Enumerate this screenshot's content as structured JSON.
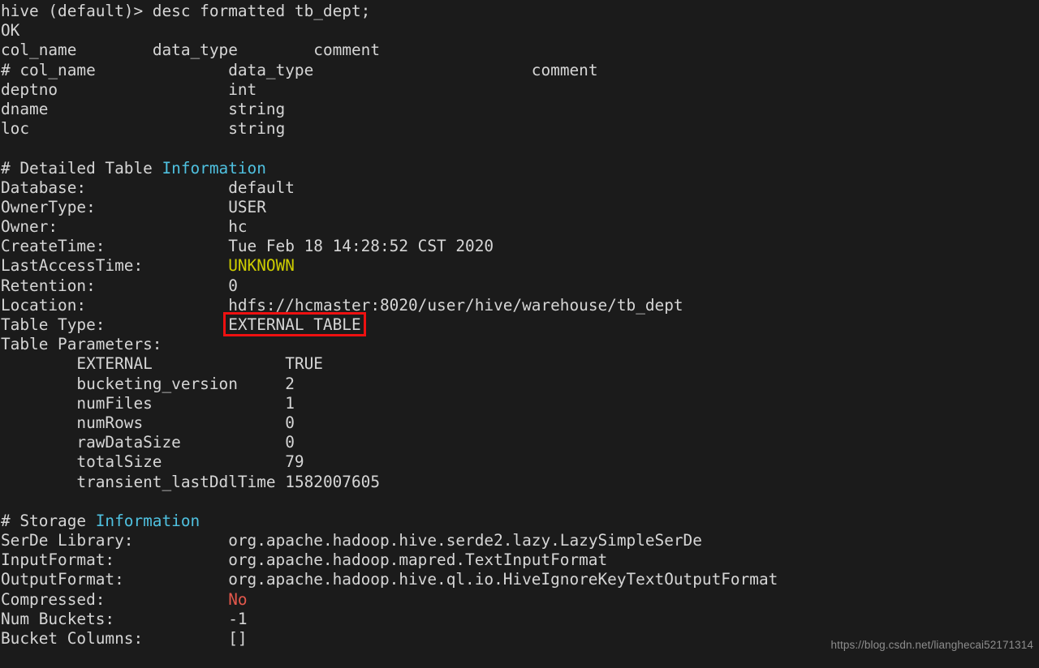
{
  "terminal": {
    "prompt": "hive (default)> ",
    "command": "desc formatted tb_dept;",
    "status_ok": "OK",
    "colors": {
      "background": "#1b1b1b",
      "foreground": "#d6d6d6",
      "cyan": "#4fc1e0",
      "yellow": "#cdcd00",
      "red": "#e4584c",
      "highlight_box": "#ee1111"
    }
  },
  "column_header": {
    "col_name": "col_name",
    "data_type": "data_type",
    "comment": "comment"
  },
  "schema": {
    "header": {
      "col_name": "# col_name",
      "data_type": "data_type",
      "comment": "comment"
    },
    "columns": [
      {
        "name": "deptno",
        "type": "int",
        "comment": ""
      },
      {
        "name": "dname",
        "type": "string",
        "comment": ""
      },
      {
        "name": "loc",
        "type": "string",
        "comment": ""
      }
    ]
  },
  "detailed_table_information": {
    "heading_prefix": "# Detailed Table ",
    "heading_highlight": "Information",
    "rows": [
      {
        "key": "Database:",
        "value": "default"
      },
      {
        "key": "OwnerType:",
        "value": "USER"
      },
      {
        "key": "Owner:",
        "value": "hc"
      },
      {
        "key": "CreateTime:",
        "value": "Tue Feb 18 14:28:52 CST 2020"
      },
      {
        "key": "LastAccessTime:",
        "value": "UNKNOWN"
      },
      {
        "key": "Retention:",
        "value": "0"
      },
      {
        "key": "Location:",
        "value": "hdfs://hcmaster:8020/user/hive/warehouse/tb_dept"
      },
      {
        "key": "Table Type:",
        "value": "EXTERNAL_TABLE"
      }
    ],
    "table_type_display": "EXTERNAL TABLE"
  },
  "table_parameters": {
    "label": "Table Parameters:",
    "entries": [
      {
        "key": "EXTERNAL",
        "value": "TRUE"
      },
      {
        "key": "bucketing_version",
        "value": "2"
      },
      {
        "key": "numFiles",
        "value": "1"
      },
      {
        "key": "numRows",
        "value": "0"
      },
      {
        "key": "rawDataSize",
        "value": "0"
      },
      {
        "key": "totalSize",
        "value": "79"
      },
      {
        "key": "transient_lastDdlTime",
        "value": "1582007605"
      }
    ]
  },
  "storage_information": {
    "heading_prefix": "# Storage ",
    "heading_highlight": "Information",
    "rows": [
      {
        "key": "SerDe Library:",
        "value": "org.apache.hadoop.hive.serde2.lazy.LazySimpleSerDe"
      },
      {
        "key": "InputFormat:",
        "value": "org.apache.hadoop.mapred.TextInputFormat"
      },
      {
        "key": "OutputFormat:",
        "value": "org.apache.hadoop.hive.ql.io.HiveIgnoreKeyTextOutputFormat"
      },
      {
        "key": "Compressed:",
        "value": "No"
      },
      {
        "key": "Num Buckets:",
        "value": "-1"
      },
      {
        "key": "Bucket Columns:",
        "value": "[]"
      }
    ]
  },
  "watermark": {
    "text": "https://blog.csdn.net/lianghecai52171314"
  },
  "padding": {
    "col24": "                        ",
    "col16": "                ",
    "indent8": "        ",
    "col48": "                                                "
  }
}
